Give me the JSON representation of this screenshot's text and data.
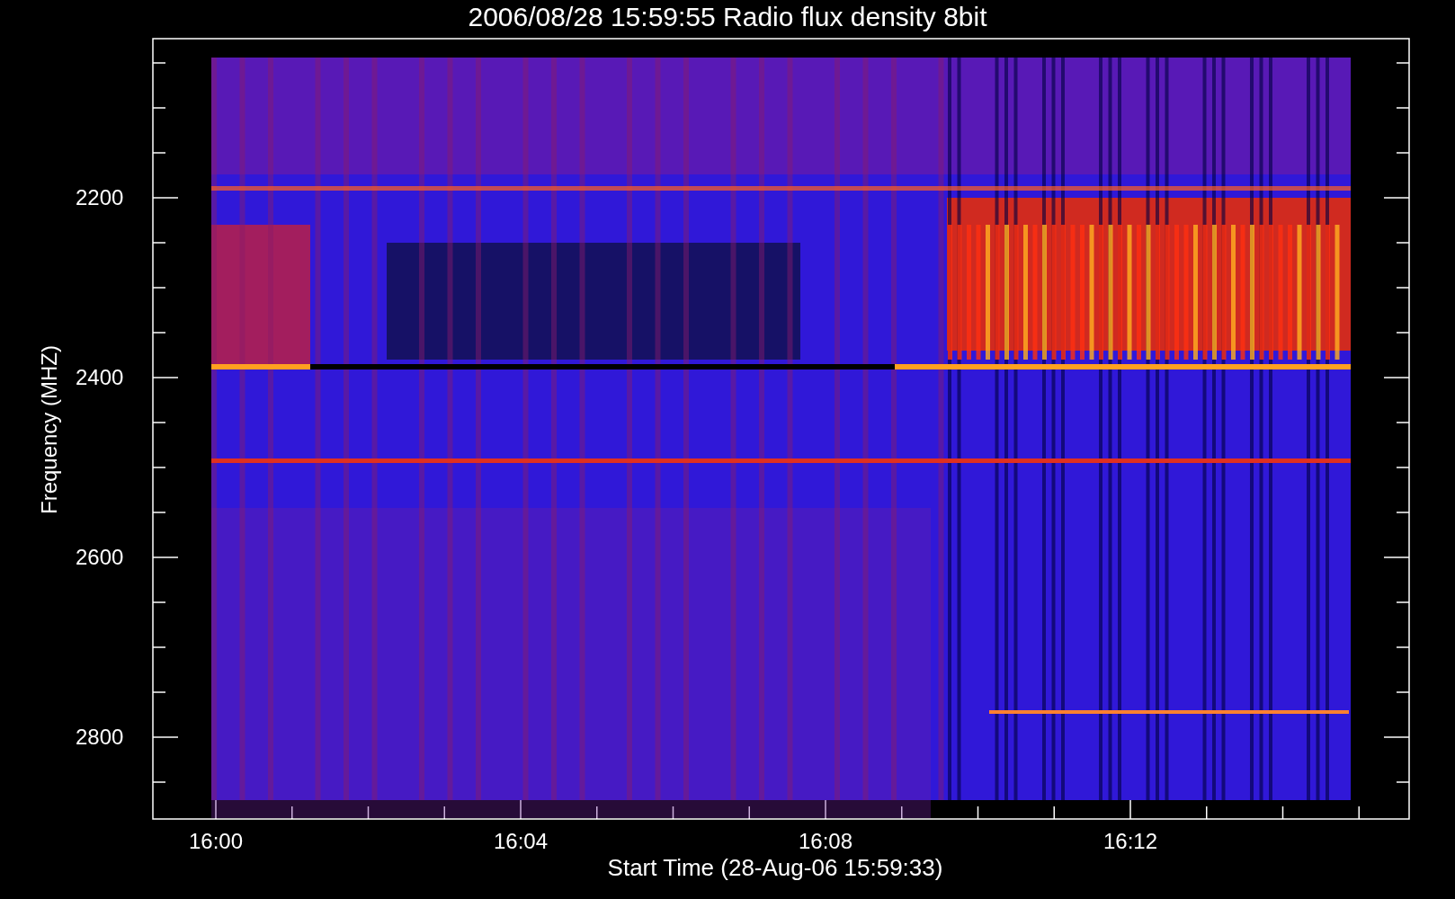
{
  "title": "2006/08/28 15:59:55 Radio flux density 8bit",
  "y_axis": {
    "title": "Frequency (MHZ)",
    "ticks": [
      "2200",
      "2400",
      "2600",
      "2800"
    ]
  },
  "x_axis": {
    "title": "Start Time (28-Aug-06 15:59:33)",
    "ticks": [
      "16:00",
      "16:04",
      "16:08",
      "16:12"
    ]
  }
}
